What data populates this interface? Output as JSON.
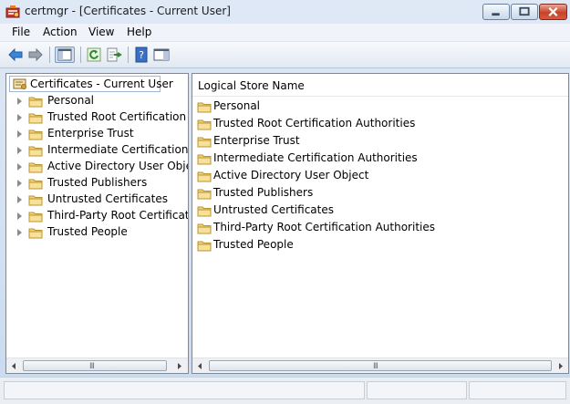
{
  "window": {
    "title": "certmgr - [Certificates - Current User]",
    "colors": {
      "accent_close": "#c8432a",
      "folder": "#f1d27a",
      "selection_border": "#9fb7d3"
    }
  },
  "menu": [
    {
      "label": "File"
    },
    {
      "label": "Action"
    },
    {
      "label": "View"
    },
    {
      "label": "Help"
    }
  ],
  "toolbar": {
    "icons": [
      "back-arrow-icon",
      "forward-arrow-icon",
      "show-hide-console-tree-icon",
      "refresh-icon",
      "export-list-icon",
      "help-icon",
      "show-hide-action-pane-icon"
    ]
  },
  "tree": {
    "root_label": "Certificates - Current User",
    "items": [
      {
        "label": "Personal"
      },
      {
        "label": "Trusted Root Certification Au"
      },
      {
        "label": "Enterprise Trust"
      },
      {
        "label": "Intermediate Certification Au"
      },
      {
        "label": "Active Directory User Object"
      },
      {
        "label": "Trusted Publishers"
      },
      {
        "label": "Untrusted Certificates"
      },
      {
        "label": "Third-Party Root Certification"
      },
      {
        "label": "Trusted People"
      }
    ]
  },
  "list": {
    "column_header": "Logical Store Name",
    "items": [
      {
        "label": "Personal"
      },
      {
        "label": "Trusted Root Certification Authorities"
      },
      {
        "label": "Enterprise Trust"
      },
      {
        "label": "Intermediate Certification Authorities"
      },
      {
        "label": "Active Directory User Object"
      },
      {
        "label": "Trusted Publishers"
      },
      {
        "label": "Untrusted Certificates"
      },
      {
        "label": "Third-Party Root Certification Authorities"
      },
      {
        "label": "Trusted People"
      }
    ]
  },
  "scrollbar": {
    "grip": "III"
  }
}
